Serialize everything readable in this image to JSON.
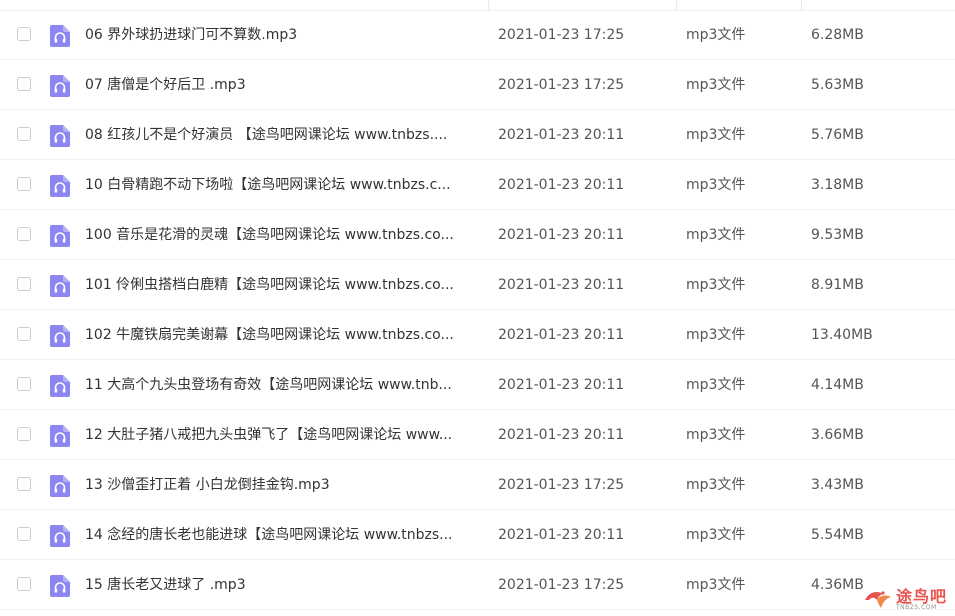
{
  "files": [
    {
      "name": "06 界外球扔进球门可不算数.mp3",
      "date": "2021-01-23 17:25",
      "type": "mp3文件",
      "size": "6.28MB"
    },
    {
      "name": "07 唐僧是个好后卫  .mp3",
      "date": "2021-01-23 17:25",
      "type": "mp3文件",
      "size": "5.63MB"
    },
    {
      "name": "08 红孩儿不是个好演员  【途鸟吧网课论坛 www.tnbzs....",
      "date": "2021-01-23 20:11",
      "type": "mp3文件",
      "size": "5.76MB"
    },
    {
      "name": "10 白骨精跑不动下场啦【途鸟吧网课论坛 www.tnbzs.c...",
      "date": "2021-01-23 20:11",
      "type": "mp3文件",
      "size": "3.18MB"
    },
    {
      "name": "100 音乐是花滑的灵魂【途鸟吧网课论坛 www.tnbzs.co...",
      "date": "2021-01-23 20:11",
      "type": "mp3文件",
      "size": "9.53MB"
    },
    {
      "name": "101 伶俐虫搭档白鹿精【途鸟吧网课论坛 www.tnbzs.co...",
      "date": "2021-01-23 20:11",
      "type": "mp3文件",
      "size": "8.91MB"
    },
    {
      "name": "102 牛魔铁扇完美谢幕【途鸟吧网课论坛 www.tnbzs.co...",
      "date": "2021-01-23 20:11",
      "type": "mp3文件",
      "size": "13.40MB"
    },
    {
      "name": "11 大高个九头虫登场有奇效【途鸟吧网课论坛 www.tnb...",
      "date": "2021-01-23 20:11",
      "type": "mp3文件",
      "size": "4.14MB"
    },
    {
      "name": "12 大肚子猪八戒把九头虫弹飞了【途鸟吧网课论坛 www...",
      "date": "2021-01-23 20:11",
      "type": "mp3文件",
      "size": "3.66MB"
    },
    {
      "name": "13 沙僧歪打正着 小白龙倒挂金钩.mp3",
      "date": "2021-01-23 17:25",
      "type": "mp3文件",
      "size": "3.43MB"
    },
    {
      "name": "14 念经的唐长老也能进球【途鸟吧网课论坛 www.tnbzs...",
      "date": "2021-01-23 20:11",
      "type": "mp3文件",
      "size": "5.54MB"
    },
    {
      "name": "15 唐长老又进球了  .mp3",
      "date": "2021-01-23 17:25",
      "type": "mp3文件",
      "size": "4.36MB"
    }
  ],
  "icons": {
    "row_checkbox": "checkbox-icon",
    "file_type": "audio-headphones-icon"
  },
  "colors": {
    "icon_bg": "#8b86f2",
    "watermark_red": "#e8413a"
  },
  "watermark": {
    "cn": "途鸟吧",
    "en": "TNBZS.COM"
  }
}
